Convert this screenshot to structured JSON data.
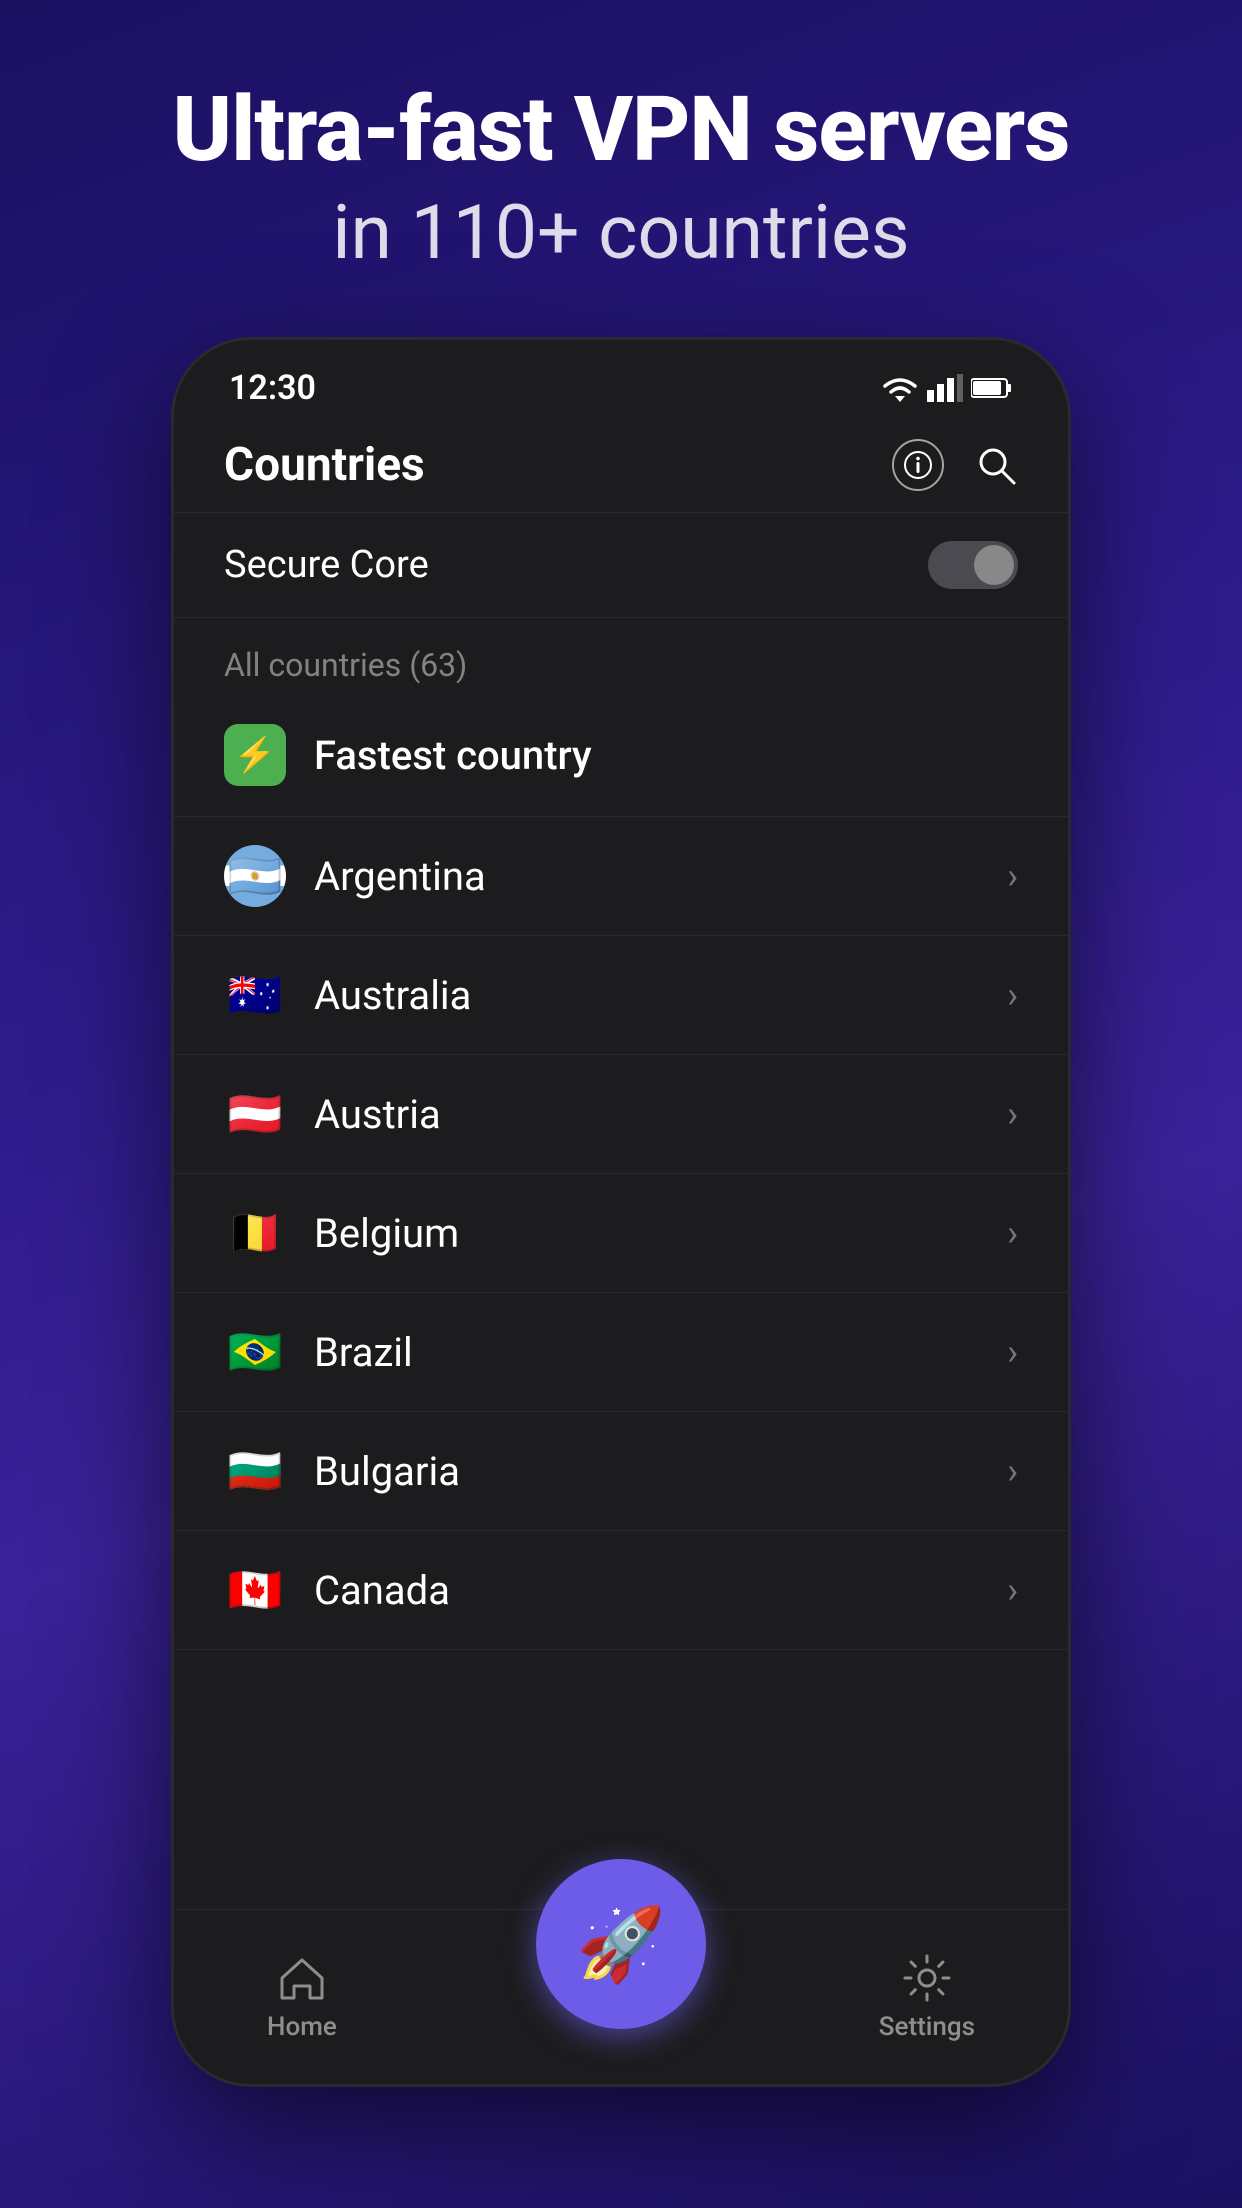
{
  "header": {
    "line1": "Ultra-fast VPN servers",
    "line2": "in 110+ countries"
  },
  "statusBar": {
    "time": "12:30"
  },
  "topBar": {
    "title": "Countries"
  },
  "secureCore": {
    "label": "Secure Core",
    "toggleState": "off"
  },
  "sectionLabel": "All countries (63)",
  "fastestCountry": {
    "label": "Fastest country",
    "icon": "⚡"
  },
  "countries": [
    {
      "name": "Argentina",
      "flagClass": "flag-argentina",
      "emoji": "🇦🇷"
    },
    {
      "name": "Australia",
      "flagClass": "flag-australia",
      "emoji": "🇦🇺"
    },
    {
      "name": "Austria",
      "flagClass": "flag-austria",
      "emoji": "🇦🇹"
    },
    {
      "name": "Belgium",
      "flagClass": "flag-belgium",
      "emoji": "🇧🇪"
    },
    {
      "name": "Brazil",
      "flagClass": "flag-brazil",
      "emoji": "🇧🇷"
    },
    {
      "name": "Bulgaria",
      "flagClass": "flag-bulgaria",
      "emoji": "🇧🇬"
    },
    {
      "name": "Canada",
      "flagClass": "flag-canada",
      "emoji": "🇨🇦"
    }
  ],
  "bottomNav": {
    "homeLabel": "Home",
    "settingsLabel": "Settings"
  }
}
